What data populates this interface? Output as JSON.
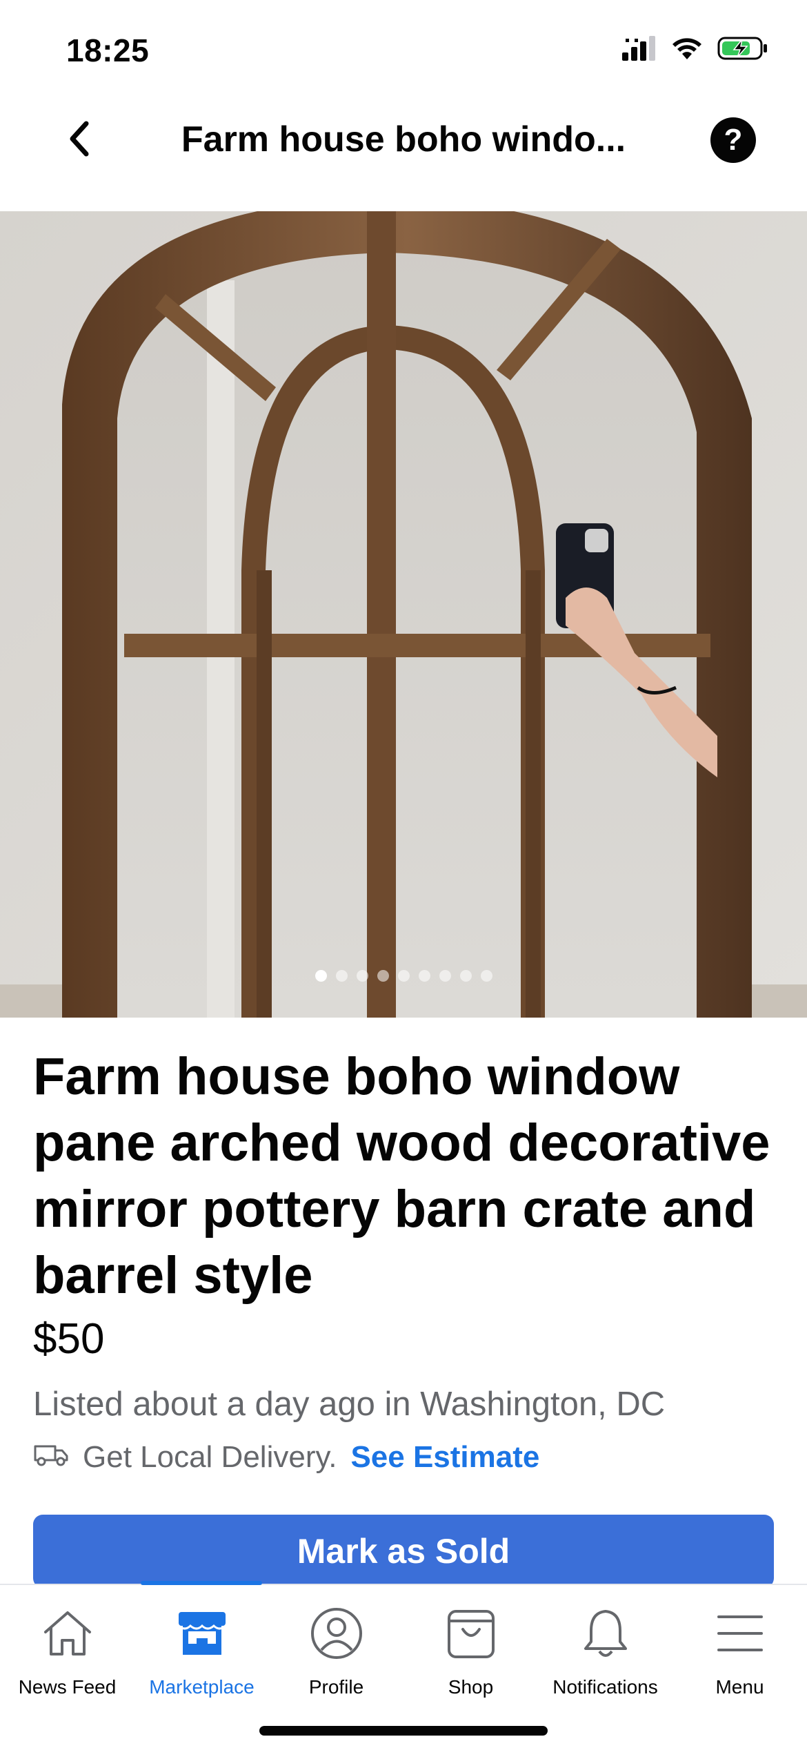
{
  "status_bar": {
    "time": "18:25",
    "icons": [
      "signal-icon",
      "wifi-icon",
      "battery-charging-icon"
    ]
  },
  "header": {
    "title": "Farm house boho windo...",
    "back_icon": "chevron-left-icon",
    "help_icon": "help-icon",
    "help_glyph": "?"
  },
  "photo": {
    "image_count": 9,
    "current_index": 0
  },
  "listing": {
    "title": "Farm house boho window pane arched wood decorative mirror pottery barn crate and barrel style",
    "price": "$50",
    "listed": "Listed about a day ago in Washington, DC",
    "delivery_text": "Get Local Delivery.",
    "delivery_link": "See Estimate",
    "delivery_icon": "truck-icon"
  },
  "actions": {
    "mark_sold": "Mark as Sold"
  },
  "tab_bar": {
    "accent": "#1b74e4",
    "active_tab": "Marketplace",
    "tabs": [
      {
        "label": "News Feed",
        "icon": "home-icon"
      },
      {
        "label": "Marketplace",
        "icon": "storefront-icon"
      },
      {
        "label": "Profile",
        "icon": "profile-icon"
      },
      {
        "label": "Shop",
        "icon": "shopping-bag-icon"
      },
      {
        "label": "Notifications",
        "icon": "bell-icon"
      },
      {
        "label": "Menu",
        "icon": "menu-icon"
      }
    ]
  },
  "colors": {
    "primary_button": "#3b6fd8",
    "link": "#1b74e4",
    "secondary_text": "#65676b"
  }
}
